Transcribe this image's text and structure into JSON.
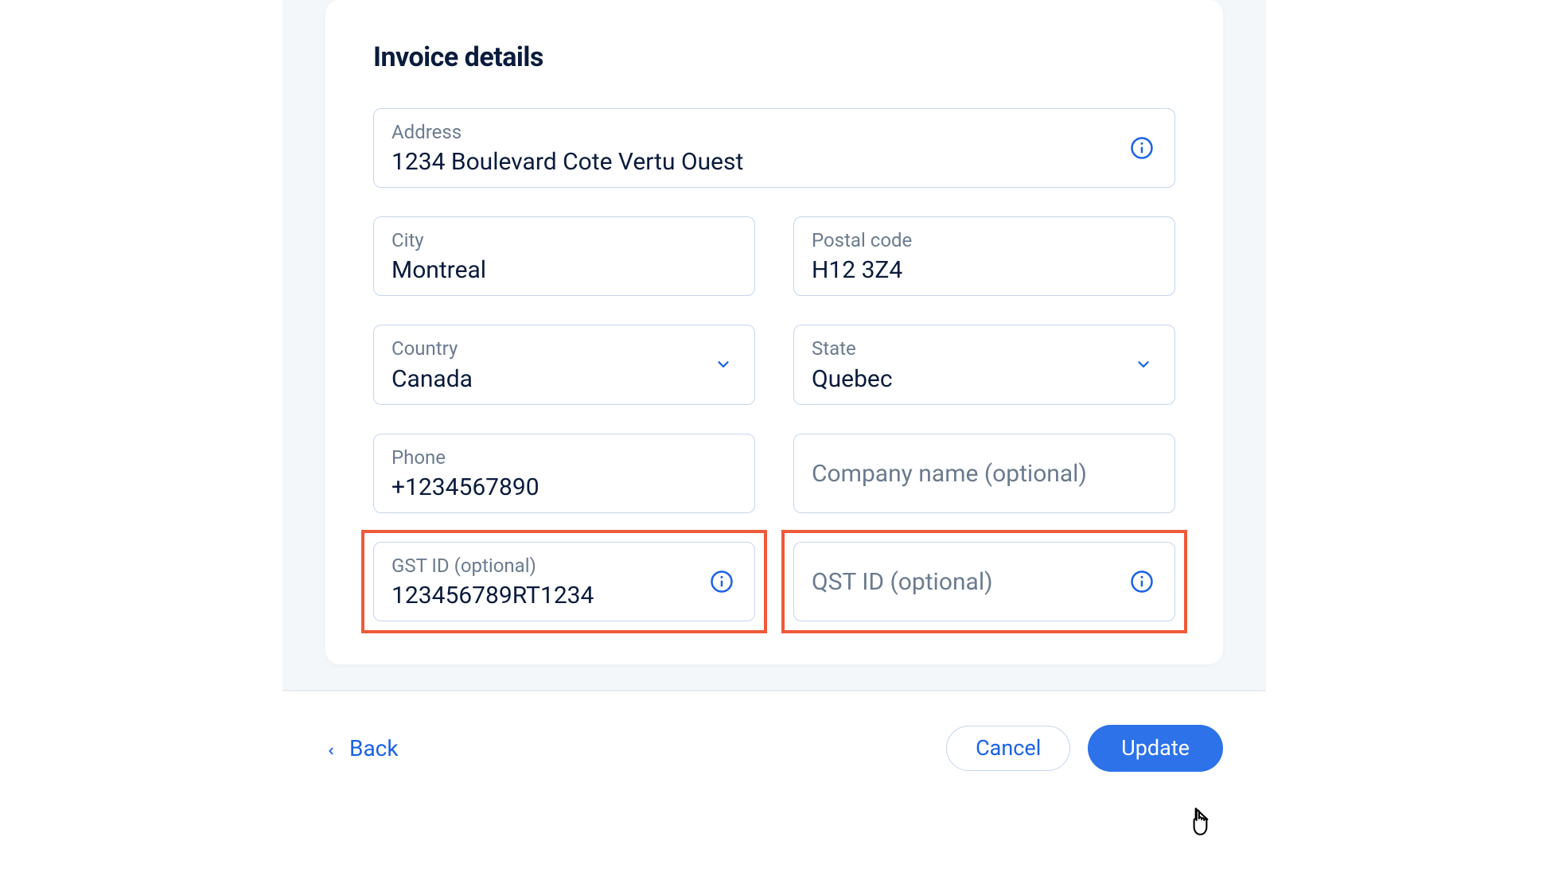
{
  "card": {
    "title": "Invoice details"
  },
  "fields": {
    "address": {
      "label": "Address",
      "value": "1234 Boulevard Cote Vertu Ouest"
    },
    "city": {
      "label": "City",
      "value": "Montreal"
    },
    "postal": {
      "label": "Postal code",
      "value": "H12 3Z4"
    },
    "country": {
      "label": "Country",
      "value": "Canada"
    },
    "state": {
      "label": "State",
      "value": "Quebec"
    },
    "phone": {
      "label": "Phone",
      "value": "+1234567890"
    },
    "company": {
      "placeholder": "Company name (optional)",
      "value": ""
    },
    "gst": {
      "label": "GST ID (optional)",
      "value": "123456789RT1234"
    },
    "qst": {
      "placeholder": "QST ID (optional)",
      "value": ""
    }
  },
  "footer": {
    "back": "Back",
    "cancel": "Cancel",
    "update": "Update"
  },
  "colors": {
    "accent": "#1a62e6",
    "highlight": "#ef5a3a",
    "border": "#c4d6ec",
    "text_dark": "#0a1b3d",
    "text_muted": "#6b7b8f"
  }
}
